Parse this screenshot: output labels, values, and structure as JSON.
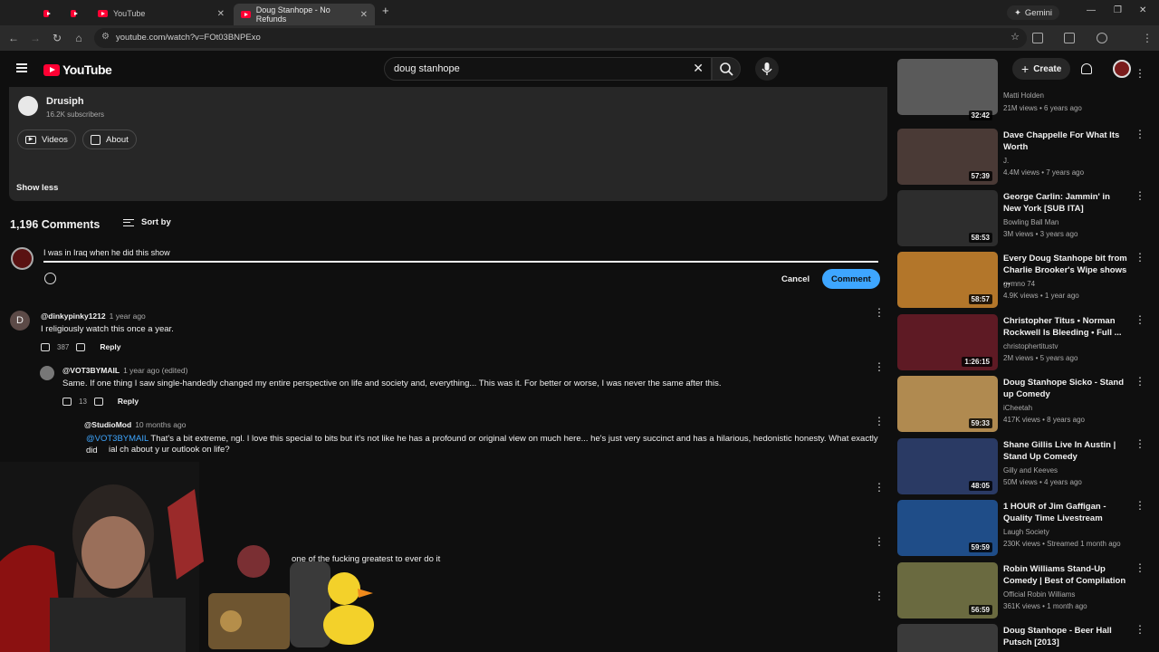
{
  "browser": {
    "tabs": [
      {
        "label": ""
      },
      {
        "label": ""
      },
      {
        "label": "YouTube"
      },
      {
        "label": "Doug Stanhope - No Refunds"
      }
    ],
    "gemini_label": "Gemini",
    "url": "youtube.com/watch?v=FOt03BNPExo"
  },
  "header": {
    "logo": "YouTube",
    "search_query": "doug stanhope",
    "create_label": "Create"
  },
  "channel": {
    "name": "Drusiph",
    "subscribers": "16.2K subscribers",
    "tabs": [
      "Videos",
      "About"
    ],
    "show_less": "Show less"
  },
  "comments": {
    "count_label": "1,196 Comments",
    "sort_label": "Sort by",
    "draft": "I was in Iraq when he did this show",
    "cancel_label": "Cancel",
    "submit_label": "Comment",
    "items": [
      {
        "initial": "D",
        "author": "@dinkypinky1212",
        "time": "1 year ago",
        "text": "I religiously watch this once a year.",
        "likes": "387",
        "reply": "Reply"
      },
      {
        "author": "@VOT3BYMAIL",
        "time": "1 year ago (edited)",
        "text": "Same. If one thing I saw single-handedly changed my entire perspective on life and society and, everything... This was it. For better or worse, I was never the same after this.",
        "likes": "13",
        "reply": "Reply"
      },
      {
        "author": "@StudioMod",
        "time": "10 months ago",
        "mention": "@VOT3BYMAIL",
        "text": "That's a bit extreme, ngl. I love this special to bits but it's not like he has a profound or original view on much here... he's just very succinct and  has a hilarious, hedonistic honesty. What exactly did",
        "text2": "ial ch    about y ur outlook on life?"
      },
      {
        "text": "one of the fucking greatest to ever do it"
      }
    ]
  },
  "sidebar": [
    {
      "title": "",
      "channel": "Matti Holden",
      "meta": "21M views • 6 years ago",
      "duration": "32:42",
      "color": "#5a5a5a"
    },
    {
      "title": "Dave Chappelle For What Its Worth",
      "channel": "J.",
      "meta": "4.4M views • 7 years ago",
      "duration": "57:39",
      "color": "#4a3a36"
    },
    {
      "title": "George Carlin: Jammin' in New York [SUB ITA]",
      "channel": "Bowling Ball Man",
      "meta": "3M views • 3 years ago",
      "duration": "58:53",
      "color": "#2d2d2d"
    },
    {
      "title": "Every Doug Stanhope bit from Charlie Brooker's Wipe shows ...",
      "channel": "gymno 74",
      "meta": "4.9K views • 1 year ago",
      "duration": "58:57",
      "color": "#b3762a"
    },
    {
      "title": "Christopher Titus • Norman Rockwell Is Bleeding • Full ...",
      "channel": "christophertitustv",
      "meta": "2M views • 5 years ago",
      "duration": "1:26:15",
      "color": "#5e1a24"
    },
    {
      "title": "Doug Stanhope Sicko - Stand up Comedy",
      "channel": "iCheetah",
      "meta": "417K views • 8 years ago",
      "duration": "59:33",
      "color": "#b08a50"
    },
    {
      "title": "Shane Gillis Live In Austin | Stand Up Comedy",
      "channel": "Gilly and Keeves",
      "meta": "50M views • 4 years ago",
      "duration": "48:05",
      "color": "#2a3a64"
    },
    {
      "title": "1 HOUR of Jim Gaffigan - Quality Time Livestream",
      "channel": "Laugh Society",
      "meta": "230K views • Streamed 1 month ago",
      "duration": "59:59",
      "color": "#1f4d88"
    },
    {
      "title": "Robin Williams Stand-Up Comedy | Best of Compilation",
      "channel": "Official Robin Williams",
      "meta": "361K views • 1 month ago",
      "duration": "56:59",
      "color": "#6a6a40"
    },
    {
      "title": "Doug Stanhope - Beer Hall Putsch [2013]",
      "channel": "",
      "meta": "",
      "duration": "",
      "color": "#3a3a3a"
    }
  ]
}
